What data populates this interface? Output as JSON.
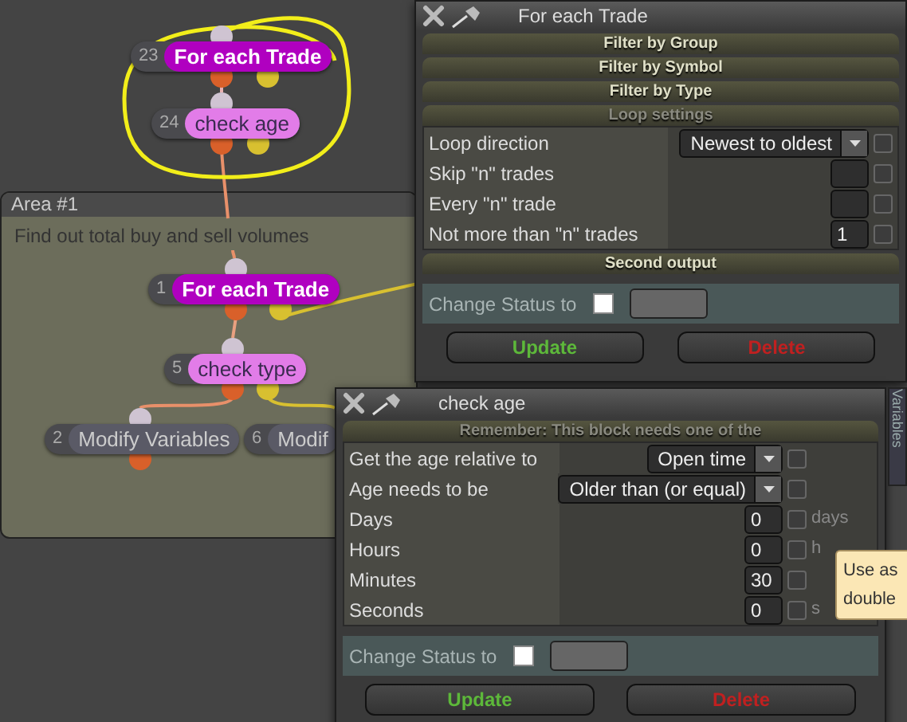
{
  "canvas": {
    "area": {
      "title": "Area #1",
      "description": "Find out total buy and sell volumes"
    },
    "nodes": [
      {
        "number": "23",
        "label": "For each Trade",
        "kind": "loop"
      },
      {
        "number": "24",
        "label": "check age",
        "kind": "condition"
      },
      {
        "number": "1",
        "label": "For each Trade",
        "kind": "loop"
      },
      {
        "number": "5",
        "label": "check type",
        "kind": "condition"
      },
      {
        "number": "2",
        "label": "Modify Variables",
        "kind": "action"
      },
      {
        "number": "6",
        "label": "Modif",
        "kind": "action"
      }
    ]
  },
  "windows": [
    {
      "title": "For each Trade",
      "sections": [
        {
          "label": "Filter by Group",
          "expanded": false
        },
        {
          "label": "Filter by Symbol",
          "expanded": false
        },
        {
          "label": "Filter by Type",
          "expanded": false
        },
        {
          "label": "Loop settings",
          "expanded": true,
          "rows": [
            {
              "label": "Loop direction",
              "kind": "select",
              "value": "Newest to oldest",
              "checked": false
            },
            {
              "label": "Skip \"n\" trades",
              "kind": "number",
              "checked": false
            },
            {
              "label": "Every \"n\" trade",
              "kind": "number",
              "checked": false
            },
            {
              "label": "Not more than \"n\" trades",
              "kind": "number",
              "value": "1",
              "checked": false
            }
          ]
        },
        {
          "label": "Second output",
          "expanded": false
        }
      ],
      "status": {
        "label": "Change Status to",
        "checked": false
      },
      "buttons": [
        {
          "label": "Update",
          "kind": "confirm"
        },
        {
          "label": "Delete",
          "kind": "danger"
        }
      ]
    },
    {
      "title": "check age",
      "sections": [
        {
          "label": "Remember: This block needs one of the",
          "expanded": true,
          "rows": [
            {
              "label": "Get the age relative to",
              "kind": "select",
              "value": "Open time",
              "checked": false
            },
            {
              "label": "Age needs to be",
              "kind": "select",
              "value": "Older than (or equal)",
              "checked": false
            },
            {
              "label": "Days",
              "kind": "number",
              "value": "0",
              "checked": false,
              "unit": "days"
            },
            {
              "label": "Hours",
              "kind": "number",
              "value": "0",
              "checked": false,
              "unit": "h"
            },
            {
              "label": "Minutes",
              "kind": "number",
              "value": "30",
              "checked": false
            },
            {
              "label": "Seconds",
              "kind": "number",
              "value": "0",
              "checked": false,
              "unit": "s"
            }
          ]
        }
      ],
      "status": {
        "label": "Change Status to",
        "checked": false
      },
      "buttons": [
        {
          "label": "Update",
          "kind": "confirm"
        },
        {
          "label": "Delete",
          "kind": "danger"
        }
      ]
    }
  ],
  "side_tab": {
    "label": "Variables"
  },
  "tooltip": {
    "lines": [
      "Use as",
      "double"
    ]
  }
}
